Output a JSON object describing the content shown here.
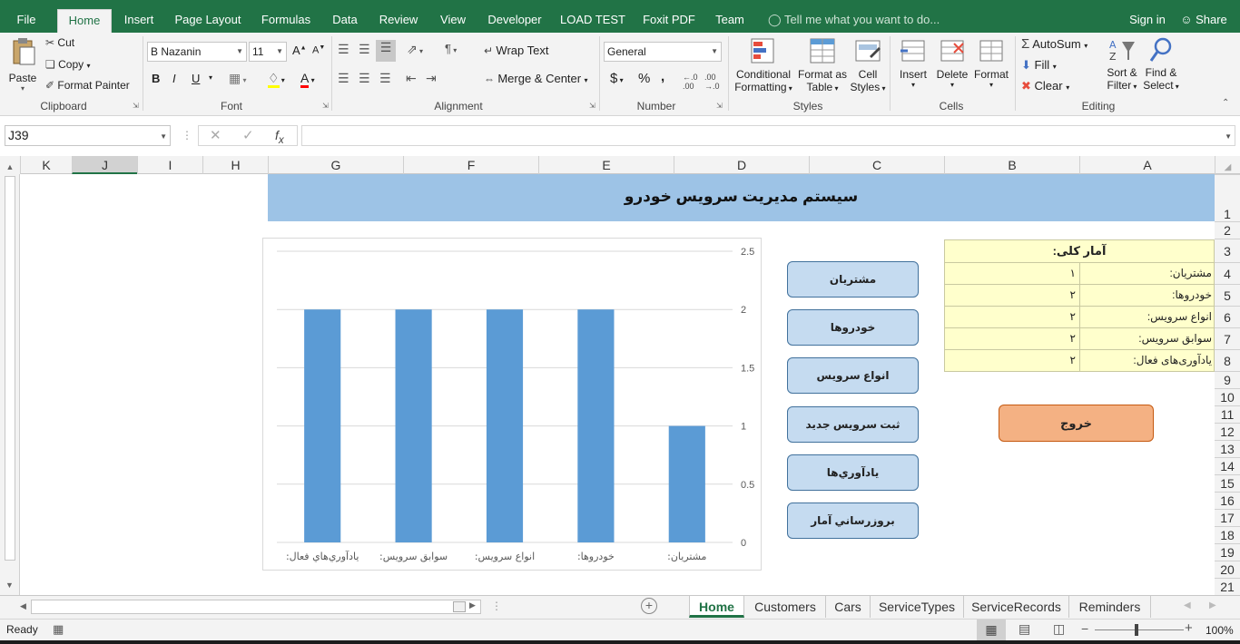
{
  "tabs": [
    {
      "label": "File"
    },
    {
      "label": "Home"
    },
    {
      "label": "Insert"
    },
    {
      "label": "Page Layout"
    },
    {
      "label": "Formulas"
    },
    {
      "label": "Data"
    },
    {
      "label": "Review"
    },
    {
      "label": "View"
    },
    {
      "label": "Developer"
    },
    {
      "label": "LOAD TEST"
    },
    {
      "label": "Foxit PDF"
    },
    {
      "label": "Team"
    }
  ],
  "tell_me": "Tell me what you want to do...",
  "sign_in": "Sign in",
  "share": "Share",
  "clipboard": {
    "paste": "Paste",
    "cut": "Cut",
    "copy": "Copy",
    "format_painter": "Format Painter",
    "label": "Clipboard"
  },
  "font": {
    "name": "B Nazanin",
    "size": "11",
    "bold": "B",
    "italic": "I",
    "underline": "U",
    "label": "Font"
  },
  "alignment": {
    "wrap": "Wrap Text",
    "merge": "Merge & Center",
    "label": "Alignment"
  },
  "number": {
    "format": "General",
    "currency": "$",
    "percent": "%",
    "comma": ",",
    "label": "Number"
  },
  "styles": {
    "cond_1": "Conditional",
    "cond_2": "Formatting",
    "fmt_1": "Format as",
    "fmt_2": "Table",
    "cell_1": "Cell",
    "cell_2": "Styles",
    "label": "Styles"
  },
  "cells": {
    "insert": "Insert",
    "delete": "Delete",
    "format": "Format",
    "label": "Cells"
  },
  "editing": {
    "autosum": "AutoSum",
    "fill": "Fill",
    "clear": "Clear",
    "sort_1": "Sort &",
    "sort_2": "Filter",
    "find_1": "Find &",
    "find_2": "Select",
    "label": "Editing"
  },
  "name_box": "J39",
  "formula_value": "",
  "columns": [
    "K",
    "J",
    "I",
    "H",
    "G",
    "F",
    "E",
    "D",
    "C",
    "B",
    "A"
  ],
  "rows": [
    "1",
    "2",
    "3",
    "4",
    "5",
    "6",
    "7",
    "8",
    "9",
    "10",
    "11",
    "12",
    "13",
    "14",
    "15",
    "16",
    "17",
    "18",
    "19",
    "20",
    "21"
  ],
  "sheet_title": "سیستم مدیریت سرویس خودرو",
  "stats": {
    "header": "آمار کلی:",
    "rows": [
      {
        "label": "مشتریان:",
        "value": "۱"
      },
      {
        "label": "خودروها:",
        "value": "۲"
      },
      {
        "label": "انواع سرویس:",
        "value": "۲"
      },
      {
        "label": "سوابق سرویس:",
        "value": "۲"
      },
      {
        "label": "یادآوری‌های فعال:",
        "value": "۲"
      }
    ]
  },
  "exit_button": "خروج",
  "nav_buttons": [
    "مشتریان",
    "خودروها",
    "انواع سرويس",
    "ثبت سرويس جديد",
    "يادآوري‌ها",
    "بروزرساني آمار"
  ],
  "chart_data": {
    "type": "bar",
    "categories": [
      "مشتريان:",
      "خودروها:",
      "انواع سرويس:",
      "سوابق سرويس:",
      "يادآوري‌هاي فعال:"
    ],
    "values": [
      1,
      2,
      2,
      2,
      2
    ],
    "yticks": [
      "0",
      "0.5",
      "1",
      "1.5",
      "2",
      "2.5"
    ],
    "ylim": [
      0,
      2.5
    ],
    "grid": true,
    "axis_side": "right",
    "bar_color": "#5b9bd5"
  },
  "sheet_tabs": [
    "Home",
    "Customers",
    "Cars",
    "ServiceTypes",
    "ServiceRecords",
    "Reminders"
  ],
  "status": {
    "ready": "Ready",
    "zoom": "100%"
  }
}
